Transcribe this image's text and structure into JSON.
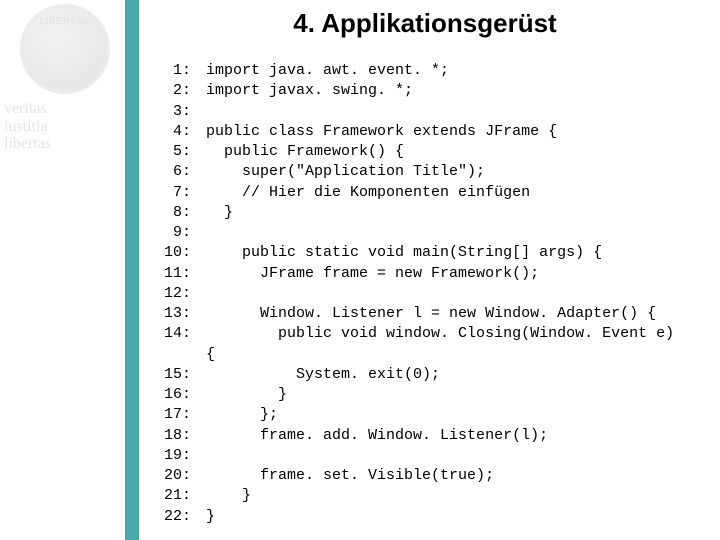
{
  "sidebar": {
    "banner_word": "LIBERTAS",
    "words": [
      "veritas",
      "iustitia",
      "libertas"
    ]
  },
  "title": "4. Applikationsgerüst",
  "code": {
    "lines": [
      {
        "n": "1",
        "text": "import java. awt. event. *;"
      },
      {
        "n": "2",
        "text": "import javax. swing. *;"
      },
      {
        "n": "3",
        "text": ""
      },
      {
        "n": "4",
        "text": "public class Framework extends JFrame {"
      },
      {
        "n": "5",
        "text": "  public Framework() {"
      },
      {
        "n": "6",
        "text": "    super(\"Application Title\");"
      },
      {
        "n": "7",
        "text": "    // Hier die Komponenten einfügen"
      },
      {
        "n": "8",
        "text": "  }"
      },
      {
        "n": "9",
        "text": ""
      },
      {
        "n": "10",
        "text": "    public static void main(String[] args) {"
      },
      {
        "n": "11",
        "text": "      JFrame frame = new Framework();"
      },
      {
        "n": "12",
        "text": ""
      },
      {
        "n": "13",
        "text": "      Window. Listener l = new Window. Adapter() {"
      },
      {
        "n": "14",
        "text": "        public void window. Closing(Window. Event e)"
      },
      {
        "n": "",
        "text": "{"
      },
      {
        "n": "15",
        "text": "          System. exit(0);"
      },
      {
        "n": "16",
        "text": "        }"
      },
      {
        "n": "17",
        "text": "      };"
      },
      {
        "n": "18",
        "text": "      frame. add. Window. Listener(l);"
      },
      {
        "n": "19",
        "text": ""
      },
      {
        "n": "20",
        "text": "      frame. set. Visible(true);"
      },
      {
        "n": "21",
        "text": "    }"
      },
      {
        "n": "22",
        "text": "}"
      }
    ]
  }
}
